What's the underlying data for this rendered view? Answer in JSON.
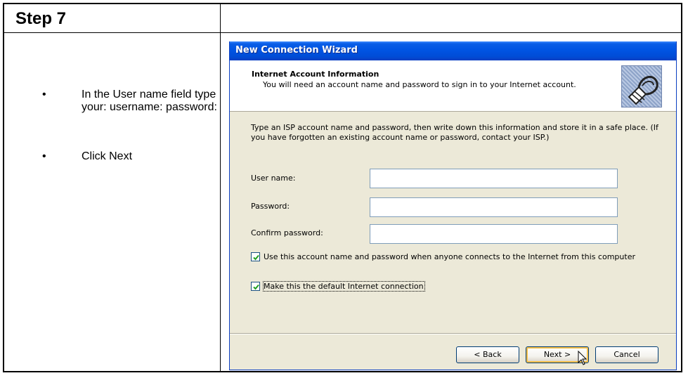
{
  "document": {
    "step_title": "Step 7",
    "instructions": [
      {
        "bullet": "•",
        "text": "In the User name field type your: username: password:"
      },
      {
        "bullet": "•",
        "text": "Click Next"
      }
    ]
  },
  "wizard": {
    "window_title": "New Connection Wizard",
    "header_title": "Internet Account Information",
    "header_subtitle": "You will need an account name and password to sign in to your Internet account.",
    "header_icon": "wizard-connection-icon",
    "intro_text": "Type an ISP account name and password, then write down this information and store it in a safe place. (If you have forgotten an existing account name or password, contact your ISP.)",
    "fields": {
      "user_name_label": "User name:",
      "user_name_value": "",
      "password_label": "Password:",
      "password_value": "",
      "confirm_password_label": "Confirm password:",
      "confirm_password_value": ""
    },
    "checkboxes": {
      "use_account_label": "Use this account  name and password when anyone connects to the Internet from this computer",
      "use_account_checked": true,
      "default_connection_label": "Make this the default Internet connection",
      "default_connection_checked": true
    },
    "buttons": {
      "back_label": "< Back",
      "next_label": "Next >",
      "cancel_label": "Cancel"
    },
    "colors": {
      "titlebar": "#0054e3",
      "dialog_face": "#ece9d8",
      "default_button_focus": "#f5bf4a"
    }
  }
}
